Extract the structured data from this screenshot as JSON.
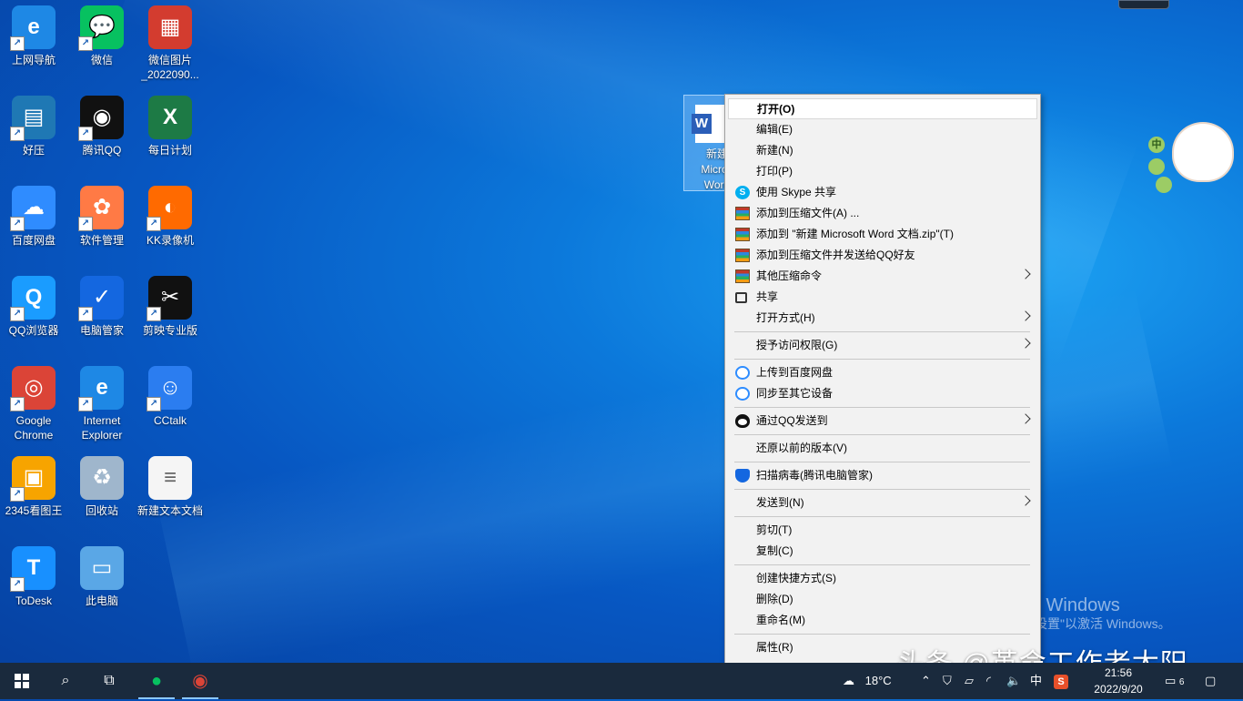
{
  "desktop_icons": [
    {
      "label": "上网导航",
      "icon": "ie-nav-icon",
      "color": "#1e88e5",
      "glyph": "e"
    },
    {
      "label": "微信",
      "icon": "wechat-icon",
      "color": "#07c160",
      "glyph": "💬"
    },
    {
      "label": "微信图片_2022090...",
      "icon": "image-file-icon",
      "color": "#d33c2f",
      "glyph": "▦"
    },
    {
      "label": "好压",
      "icon": "haozip-icon",
      "color": "#1f78b4",
      "glyph": "▤"
    },
    {
      "label": "腾讯QQ",
      "icon": "qq-icon",
      "color": "#111111",
      "glyph": "◉"
    },
    {
      "label": "每日计划",
      "icon": "excel-file-icon",
      "color": "#1d7a45",
      "glyph": "X"
    },
    {
      "label": "百度网盘",
      "icon": "baidu-netdisk-icon",
      "color": "#2f8cff",
      "glyph": "☁"
    },
    {
      "label": "软件管理",
      "icon": "software-manager-icon",
      "color": "#ff7a45",
      "glyph": "✿"
    },
    {
      "label": "KK录像机",
      "icon": "kk-recorder-icon",
      "color": "#ff6a00",
      "glyph": "◐"
    },
    {
      "label": "QQ浏览器",
      "icon": "qq-browser-icon",
      "color": "#1a9cff",
      "glyph": "Q"
    },
    {
      "label": "电脑管家",
      "icon": "pc-manager-icon",
      "color": "#1467e0",
      "glyph": "✓"
    },
    {
      "label": "剪映专业版",
      "icon": "capcut-icon",
      "color": "#111111",
      "glyph": "✂"
    },
    {
      "label": "Google Chrome",
      "icon": "chrome-icon",
      "color": "#db4437",
      "glyph": "◎"
    },
    {
      "label": "Internet Explorer",
      "icon": "internet-explorer-icon",
      "color": "#1e88e5",
      "glyph": "e"
    },
    {
      "label": "CCtalk",
      "icon": "cctalk-icon",
      "color": "#2b7df0",
      "glyph": "☺"
    },
    {
      "label": "2345看图王",
      "icon": "2345-viewer-icon",
      "color": "#f7a400",
      "glyph": "▣"
    },
    {
      "label": "回收站",
      "icon": "recycle-bin-icon",
      "color": "#9fb6cc",
      "glyph": "♻"
    },
    {
      "label": "新建文本文档",
      "icon": "text-file-icon",
      "color": "#f5f5f5",
      "glyph": "≡"
    },
    {
      "label": "ToDesk",
      "icon": "todesk-icon",
      "color": "#1890ff",
      "glyph": "T"
    },
    {
      "label": "此电脑",
      "icon": "this-pc-icon",
      "color": "#5aa7e6",
      "glyph": "▭"
    }
  ],
  "selected_file": {
    "label_lines": [
      "新建",
      "Micros",
      "Word"
    ]
  },
  "context_menu": [
    {
      "label": "打开(O)",
      "bold": true,
      "icon": "",
      "submenu": false,
      "highlighted": true
    },
    {
      "label": "编辑(E)",
      "icon": "",
      "submenu": false
    },
    {
      "label": "新建(N)",
      "icon": "",
      "submenu": false
    },
    {
      "label": "打印(P)",
      "icon": "",
      "submenu": false
    },
    {
      "label": "使用 Skype 共享",
      "icon": "skype-icon",
      "submenu": false
    },
    {
      "label": "添加到压缩文件(A) ...",
      "icon": "haozip-icon",
      "submenu": false
    },
    {
      "label": "添加到 \"新建 Microsoft Word 文档.zip\"(T)",
      "icon": "haozip-icon",
      "submenu": false
    },
    {
      "label": "添加到压缩文件并发送给QQ好友",
      "icon": "haozip-icon",
      "submenu": false
    },
    {
      "label": "其他压缩命令",
      "icon": "haozip-icon",
      "submenu": true
    },
    {
      "label": "共享",
      "icon": "share-icon",
      "submenu": false
    },
    {
      "label": "打开方式(H)",
      "icon": "",
      "submenu": true
    },
    {
      "separator": true
    },
    {
      "label": "授予访问权限(G)",
      "icon": "",
      "submenu": true
    },
    {
      "separator": true
    },
    {
      "label": "上传到百度网盘",
      "icon": "baidu-netdisk-icon",
      "submenu": false
    },
    {
      "label": "同步至其它设备",
      "icon": "baidu-netdisk-icon",
      "submenu": false
    },
    {
      "separator": true
    },
    {
      "label": "通过QQ发送到",
      "icon": "qq-icon",
      "submenu": true
    },
    {
      "separator": true
    },
    {
      "label": "还原以前的版本(V)",
      "icon": "",
      "submenu": false
    },
    {
      "separator": true
    },
    {
      "label": "扫描病毒(腾讯电脑管家)",
      "icon": "pc-manager-icon",
      "submenu": false
    },
    {
      "separator": true
    },
    {
      "label": "发送到(N)",
      "icon": "",
      "submenu": true
    },
    {
      "separator": true
    },
    {
      "label": "剪切(T)",
      "icon": "",
      "submenu": false
    },
    {
      "label": "复制(C)",
      "icon": "",
      "submenu": false
    },
    {
      "separator": true
    },
    {
      "label": "创建快捷方式(S)",
      "icon": "",
      "submenu": false
    },
    {
      "label": "删除(D)",
      "icon": "",
      "submenu": false
    },
    {
      "label": "重命名(M)",
      "icon": "",
      "submenu": false
    },
    {
      "separator": true
    },
    {
      "label": "属性(R)",
      "icon": "",
      "submenu": false
    }
  ],
  "watermark": {
    "line1": "激活 Windows",
    "line2": "转到\"设置\"以激活 Windows。"
  },
  "credit": "头条 @革命工作者太阳",
  "sticker": {
    "bubble1": "中"
  },
  "taskbar": {
    "pinned": [
      "wechat-icon",
      "chrome-icon"
    ],
    "weather": "18°C",
    "ime": "中",
    "time": "21:56",
    "date": "2022/9/20",
    "notification_count": "6"
  }
}
